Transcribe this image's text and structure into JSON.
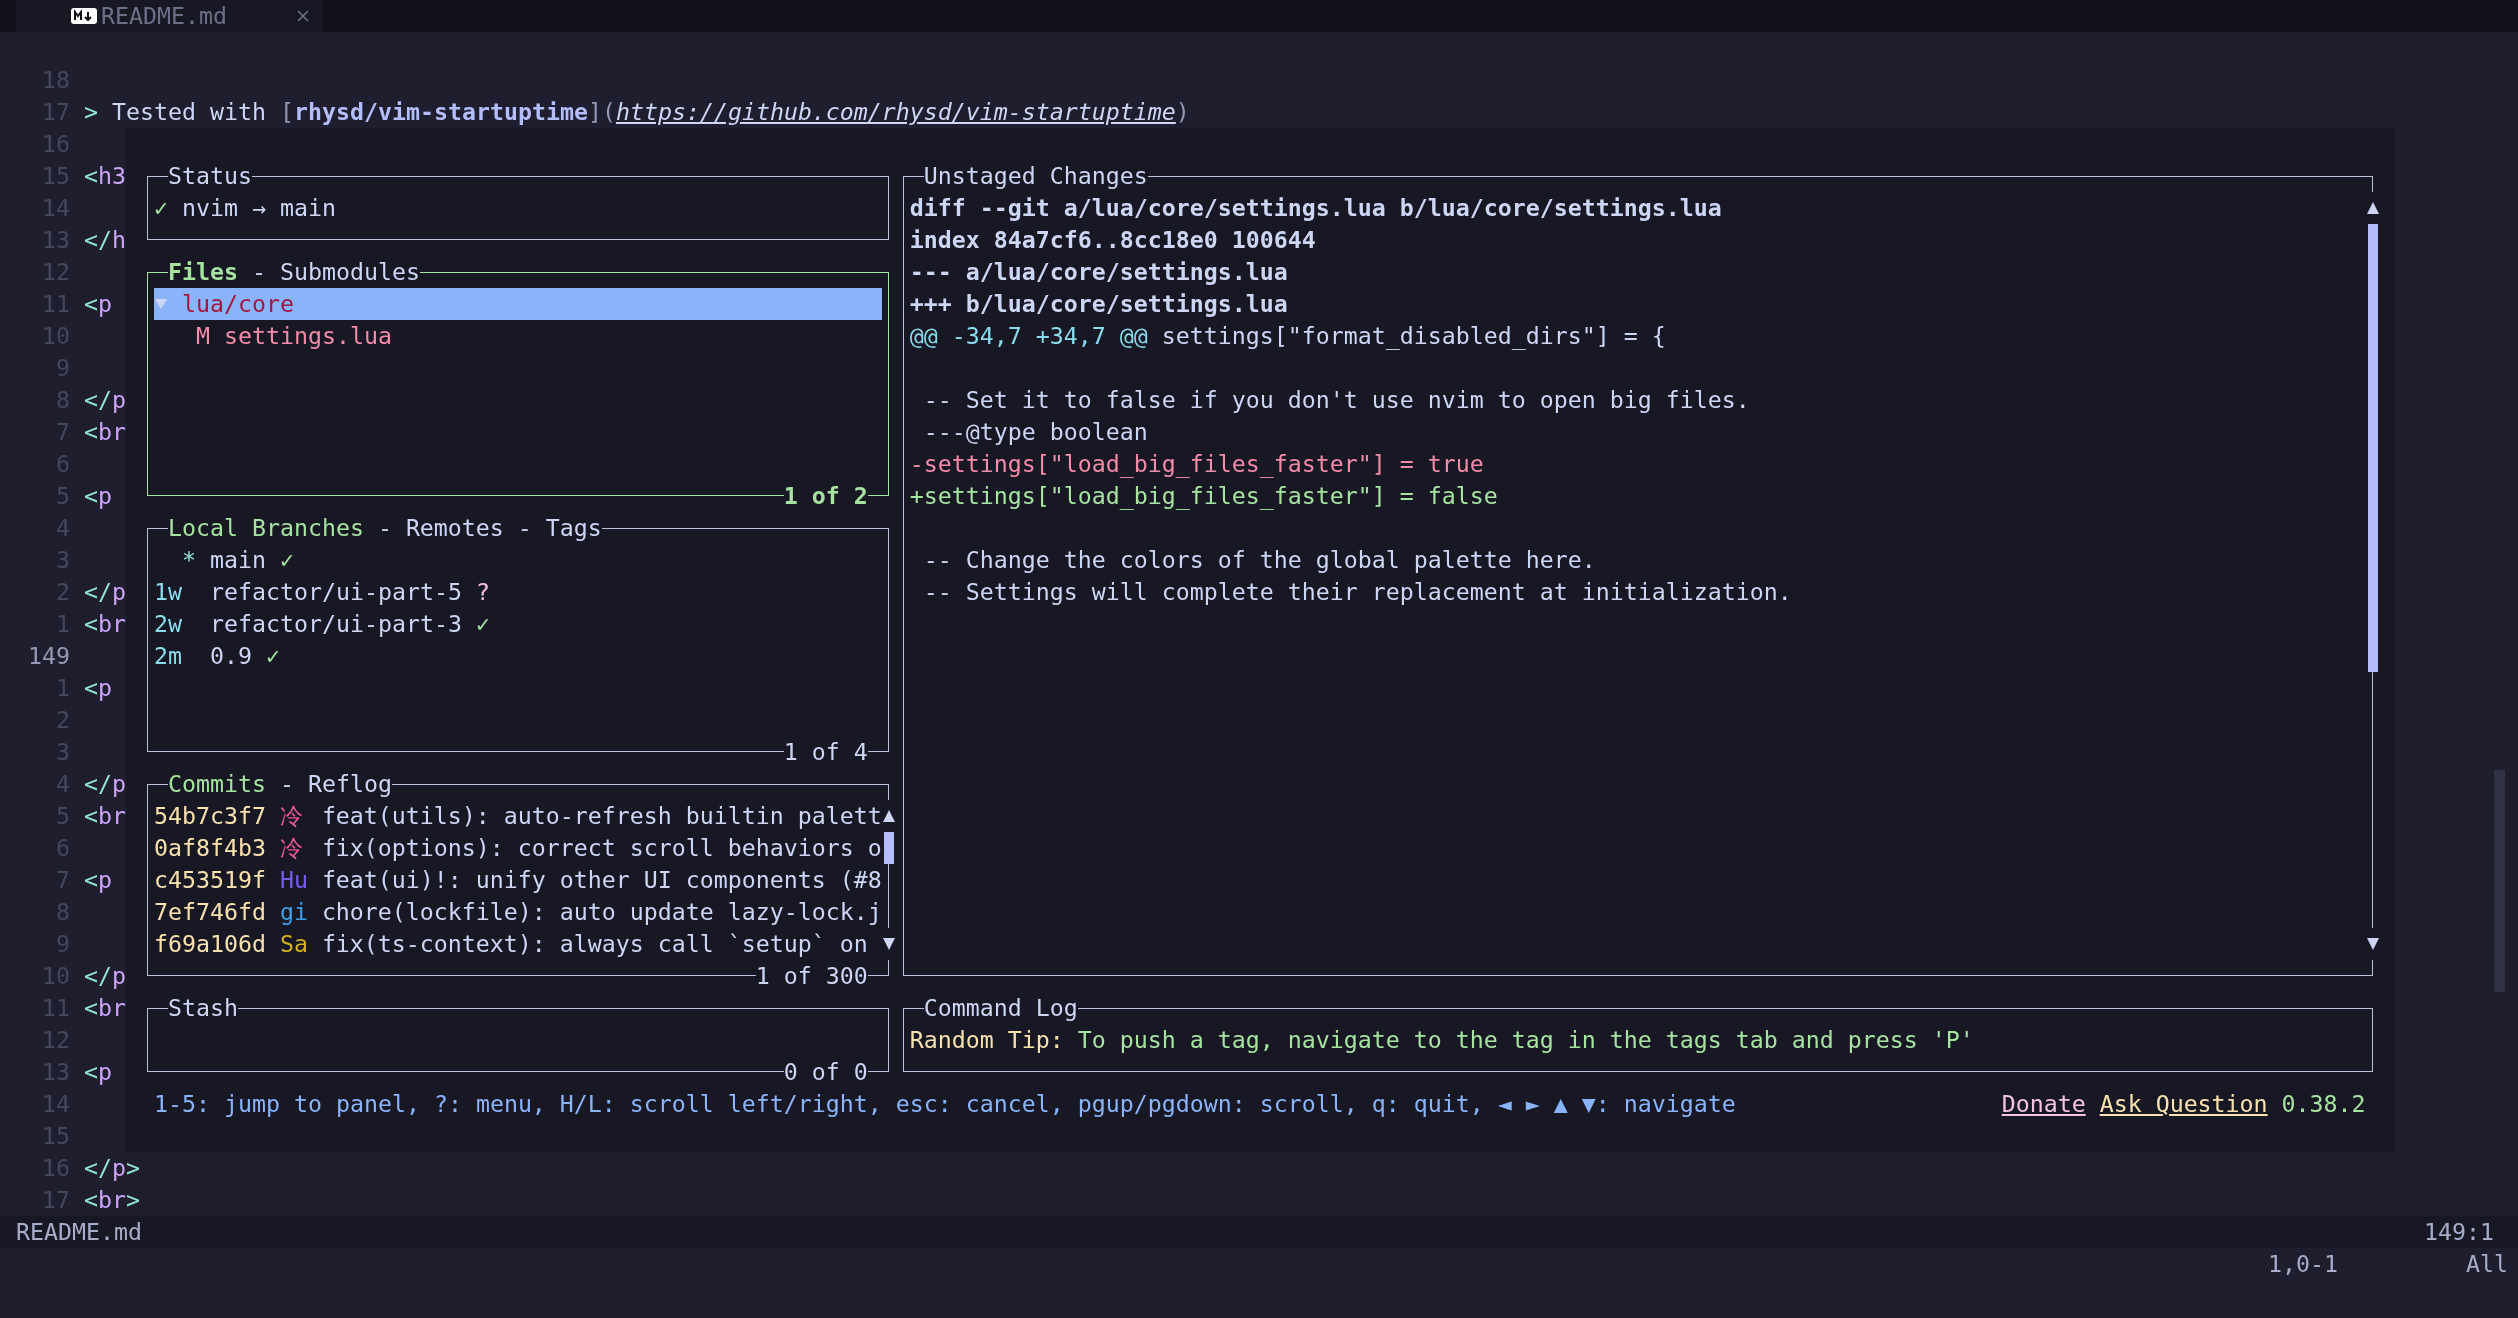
{
  "tab": {
    "label": "README.md"
  },
  "editor": {
    "lines": [
      {
        "number": "18",
        "current": false
      },
      {
        "number": "17",
        "current": false,
        "segments": [
          {
            "kind": "quote",
            "text": ">"
          },
          {
            "kind": "text",
            "text": " Tested with "
          },
          {
            "kind": "bracket",
            "text": "["
          },
          {
            "kind": "link_text",
            "text": "rhysd/vim-startuptime"
          },
          {
            "kind": "bracket",
            "text": "]("
          },
          {
            "kind": "url",
            "text": "https://github.com/rhysd/vim-startuptime"
          },
          {
            "kind": "bracket",
            "text": ")"
          }
        ]
      },
      {
        "number": "16",
        "current": false
      },
      {
        "number": "15",
        "current": false,
        "segments": [
          {
            "kind": "punct",
            "text": "<"
          },
          {
            "kind": "tag",
            "text": "h3"
          }
        ]
      },
      {
        "number": "14",
        "current": false
      },
      {
        "number": "13",
        "current": false,
        "segments": [
          {
            "kind": "punct",
            "text": "</"
          },
          {
            "kind": "tag",
            "text": "h"
          }
        ]
      },
      {
        "number": "12",
        "current": false
      },
      {
        "number": "11",
        "current": false,
        "segments": [
          {
            "kind": "punct",
            "text": "<"
          },
          {
            "kind": "tag",
            "text": "p"
          }
        ]
      },
      {
        "number": "10",
        "current": false
      },
      {
        "number": "9",
        "current": false
      },
      {
        "number": "8",
        "current": false,
        "segments": [
          {
            "kind": "punct",
            "text": "</"
          },
          {
            "kind": "tag",
            "text": "p"
          }
        ]
      },
      {
        "number": "7",
        "current": false,
        "segments": [
          {
            "kind": "punct",
            "text": "<"
          },
          {
            "kind": "tag",
            "text": "br"
          }
        ]
      },
      {
        "number": "6",
        "current": false
      },
      {
        "number": "5",
        "current": false,
        "segments": [
          {
            "kind": "punct",
            "text": "<"
          },
          {
            "kind": "tag",
            "text": "p"
          }
        ]
      },
      {
        "number": "4",
        "current": false
      },
      {
        "number": "3",
        "current": false
      },
      {
        "number": "2",
        "current": false,
        "segments": [
          {
            "kind": "punct",
            "text": "</"
          },
          {
            "kind": "tag",
            "text": "p"
          }
        ]
      },
      {
        "number": "1",
        "current": false,
        "segments": [
          {
            "kind": "punct",
            "text": "<"
          },
          {
            "kind": "tag",
            "text": "br"
          }
        ]
      },
      {
        "number": "149",
        "current": true
      },
      {
        "number": "1",
        "current": false,
        "segments": [
          {
            "kind": "punct",
            "text": "<"
          },
          {
            "kind": "tag",
            "text": "p"
          }
        ]
      },
      {
        "number": "2",
        "current": false
      },
      {
        "number": "3",
        "current": false
      },
      {
        "number": "4",
        "current": false,
        "segments": [
          {
            "kind": "punct",
            "text": "</"
          },
          {
            "kind": "tag",
            "text": "p"
          }
        ]
      },
      {
        "number": "5",
        "current": false,
        "segments": [
          {
            "kind": "punct",
            "text": "<"
          },
          {
            "kind": "tag",
            "text": "br"
          }
        ]
      },
      {
        "number": "6",
        "current": false
      },
      {
        "number": "7",
        "current": false,
        "segments": [
          {
            "kind": "punct",
            "text": "<"
          },
          {
            "kind": "tag",
            "text": "p"
          }
        ]
      },
      {
        "number": "8",
        "current": false
      },
      {
        "number": "9",
        "current": false
      },
      {
        "number": "10",
        "current": false,
        "segments": [
          {
            "kind": "punct",
            "text": "</"
          },
          {
            "kind": "tag",
            "text": "p"
          }
        ]
      },
      {
        "number": "11",
        "current": false,
        "segments": [
          {
            "kind": "punct",
            "text": "<"
          },
          {
            "kind": "tag",
            "text": "br"
          }
        ]
      },
      {
        "number": "12",
        "current": false
      },
      {
        "number": "13",
        "current": false,
        "segments": [
          {
            "kind": "punct",
            "text": "<"
          },
          {
            "kind": "tag",
            "text": "p"
          }
        ]
      },
      {
        "number": "14",
        "current": false
      },
      {
        "number": "15",
        "current": false
      },
      {
        "number": "16",
        "current": false,
        "segments": [
          {
            "kind": "punct",
            "text": "</"
          },
          {
            "kind": "tag",
            "text": "p"
          },
          {
            "kind": "punct",
            "text": ">"
          }
        ]
      },
      {
        "number": "17",
        "current": false,
        "segments": [
          {
            "kind": "punct",
            "text": "<"
          },
          {
            "kind": "tag",
            "text": "br"
          },
          {
            "kind": "punct",
            "text": ">"
          }
        ]
      }
    ]
  },
  "lazygit": {
    "left_panels": [
      {
        "kind": "status",
        "active": false,
        "title": "Status",
        "check": "✓",
        "text": "nvim → main"
      },
      {
        "kind": "files",
        "active": true,
        "tabs": [
          {
            "label": "Files",
            "selected": true
          },
          {
            "label": "Submodules",
            "selected": false
          }
        ],
        "tab_separator": "-",
        "tree": [
          {
            "label": "lua/core",
            "selected": true,
            "expanded": true,
            "children": [
              {
                "status": "M",
                "label": "settings.lua",
                "selected": false
              }
            ]
          }
        ],
        "footer": "1 of 2"
      },
      {
        "kind": "branches",
        "active": false,
        "tabs": [
          {
            "label": "Local Branches",
            "selected": true
          },
          {
            "label": "Remotes",
            "selected": false
          },
          {
            "label": "Tags",
            "selected": false
          }
        ],
        "tab_separator": "-",
        "items": [
          {
            "marker": "*",
            "name": "main",
            "status": "✓",
            "color": "#a6e3a1"
          },
          {
            "age": "1w",
            "name": "refactor/ui-part-5",
            "status": "?",
            "color": "#f5c2e7"
          },
          {
            "age": "2w",
            "name": "refactor/ui-part-3",
            "status": "✓",
            "color": "#a6e3a1"
          },
          {
            "age": "2m",
            "name": "0.9",
            "status": "✓",
            "color": "#a6e3a1"
          }
        ],
        "footer": "1 of 4"
      },
      {
        "kind": "commits",
        "active": false,
        "tabs": [
          {
            "label": "Commits",
            "selected": true
          },
          {
            "label": "Reflog",
            "selected": false
          }
        ],
        "tab_separator": "-",
        "items": [
          {
            "hash": "54b7c3f7",
            "author": "冷",
            "color": "#e8559a",
            "message": "feat(utils): auto-refresh builtin palett"
          },
          {
            "hash": "0af8f4b3",
            "author": "冷",
            "color": "#e8559a",
            "message": "fix(options): correct scroll behaviors o"
          },
          {
            "hash": "c453519f",
            "author": "Hu",
            "color": "#7a5af0",
            "message": "feat(ui)!: unify other UI components (#8"
          },
          {
            "hash": "7ef746fd",
            "author": "gi",
            "color": "#3f9ee8",
            "message": "chore(lockfile): auto update lazy-lock.j"
          },
          {
            "hash": "f69a106d",
            "author": "Sa",
            "color": "#d2b21c",
            "message": "fix(ts-context): always call `setup` on"
          }
        ],
        "footer": "1 of 300"
      },
      {
        "kind": "stash",
        "active": false,
        "title": "Stash",
        "footer": "0 of 0"
      }
    ],
    "right_panels": [
      {
        "kind": "diff",
        "active": false,
        "title": "Unstaged Changes",
        "lines": [
          {
            "kind": "header",
            "text": "diff --git a/lua/core/settings.lua b/lua/core/settings.lua"
          },
          {
            "kind": "header",
            "text": "index 84a7cf6..8cc18e0 100644"
          },
          {
            "kind": "header",
            "text": "--- a/lua/core/settings.lua"
          },
          {
            "kind": "header",
            "text": "+++ b/lua/core/settings.lua"
          },
          {
            "kind": "hunk",
            "range": "@@ -34,7 +34,7 @@",
            "text": " settings[\"format_disabled_dirs\"] = {"
          },
          {
            "kind": "blank"
          },
          {
            "kind": "context",
            "text": " -- Set it to false if you don't use nvim to open big files."
          },
          {
            "kind": "context",
            "text": " ---@type boolean"
          },
          {
            "kind": "removed",
            "text": "-settings[\"load_big_files_faster\"] = true"
          },
          {
            "kind": "added",
            "text": "+settings[\"load_big_files_faster\"] = false"
          },
          {
            "kind": "blank"
          },
          {
            "kind": "context",
            "text": " -- Change the colors of the global palette here."
          },
          {
            "kind": "context",
            "text": " -- Settings will complete their replacement at initialization."
          }
        ]
      },
      {
        "kind": "log",
        "active": false,
        "title": "Command Log",
        "label": "Random Tip:",
        "text": "To push a tag, navigate to the tag in the tags tab and press 'P'"
      }
    ],
    "bottom_bar": {
      "hint": "1-5: jump to panel, ?: menu, H/L: scroll left/right, esc: cancel, pgup/pgdown: scroll, q: quit, ◄ ► ▲ ▼: navigate",
      "links": [
        {
          "label": "Donate",
          "color": "#f5c2e7"
        },
        {
          "label": "Ask Question",
          "color": "#f9e2af"
        }
      ],
      "version": "0.38.2"
    }
  },
  "status_line": {
    "file": "README.md",
    "position": "149:1"
  },
  "command_line": {
    "position": "1,0-1",
    "scroll": "All"
  }
}
